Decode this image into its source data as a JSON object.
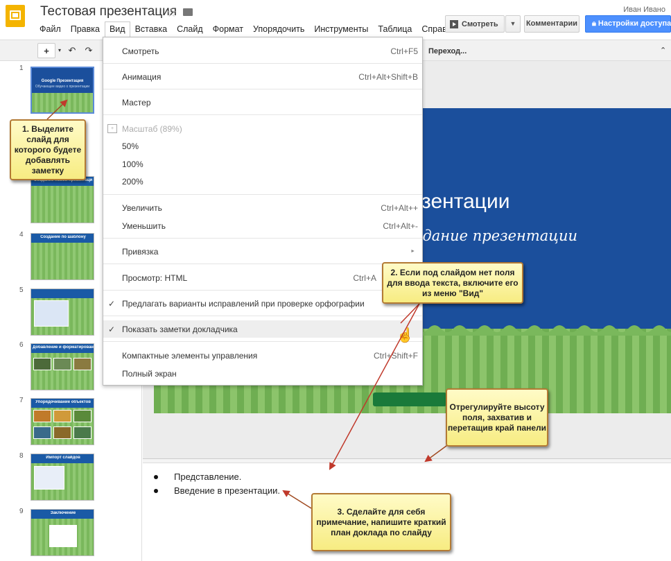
{
  "app": {
    "title": "Тестовая презентация",
    "user": "Иван Ивано"
  },
  "menubar": [
    "Файл",
    "Правка",
    "Вид",
    "Вставка",
    "Слайд",
    "Формат",
    "Упорядочить",
    "Инструменты",
    "Таблица",
    "Справка"
  ],
  "header_buttons": {
    "view": "Смотреть",
    "comments": "Комментарии",
    "share": "Настройки доступа"
  },
  "toolbar": {
    "goto": "Переход..."
  },
  "view_menu": {
    "items": [
      {
        "label": "Смотреть",
        "shortcut": "Ctrl+F5"
      },
      {
        "label": "Анимация",
        "shortcut": "Ctrl+Alt+Shift+B"
      },
      {
        "label": "Мастер",
        "shortcut": ""
      },
      {
        "label": "Масштаб (89%)",
        "shortcut": ""
      },
      {
        "label": "50%",
        "shortcut": ""
      },
      {
        "label": "100%",
        "shortcut": ""
      },
      {
        "label": "200%",
        "shortcut": ""
      },
      {
        "label": "Увеличить",
        "shortcut": "Ctrl+Alt++"
      },
      {
        "label": "Уменьшить",
        "shortcut": "Ctrl+Alt+-"
      },
      {
        "label": "Привязка",
        "shortcut": ""
      },
      {
        "label": "Просмотр: HTML",
        "shortcut": "Ctrl+A"
      },
      {
        "label": "Предлагать варианты исправлений при проверке орфографии",
        "shortcut": ""
      },
      {
        "label": "Показать заметки докладчика",
        "shortcut": ""
      },
      {
        "label": "Компактные элементы управления",
        "shortcut": "Ctrl+Shift+F"
      },
      {
        "label": "Полный экран",
        "shortcut": ""
      }
    ]
  },
  "slides": {
    "numbers": [
      "1",
      "4",
      "5",
      "6",
      "7",
      "8",
      "9"
    ],
    "captions": {
      "s1_title": "Google Презентация",
      "s1_sub": "Обучающее видео о презентации",
      "s3": "Создание новой презентаци",
      "s4": "Создание по шаблону",
      "s6": "Добавление и форматирование объектов",
      "s7": "Упорядочивание объектов",
      "s8": "Импорт слайдов",
      "s9": "Заключение"
    }
  },
  "main_slide": {
    "title": "езентации",
    "subtitle": "здание презентации"
  },
  "notes": [
    "Представление.",
    "Введение в презентации."
  ],
  "callouts": {
    "c1": "1. Выделите слайд для которого будете добавлять заметку",
    "c2": "2. Если под слайдом нет поля для ввода текста, включите его из меню \"Вид\"",
    "c3": "Отрегулируйте высоту поля, захватив и перетащив край панели",
    "c4": "3. Сделайте для себя примечание, напишите краткий план доклада по слайду"
  },
  "colors": {
    "slide_blue": "#1b4f9c",
    "grass": "#7ab85c",
    "callout_fill": "#f7ec82",
    "share_blue": "#4d90fe"
  }
}
